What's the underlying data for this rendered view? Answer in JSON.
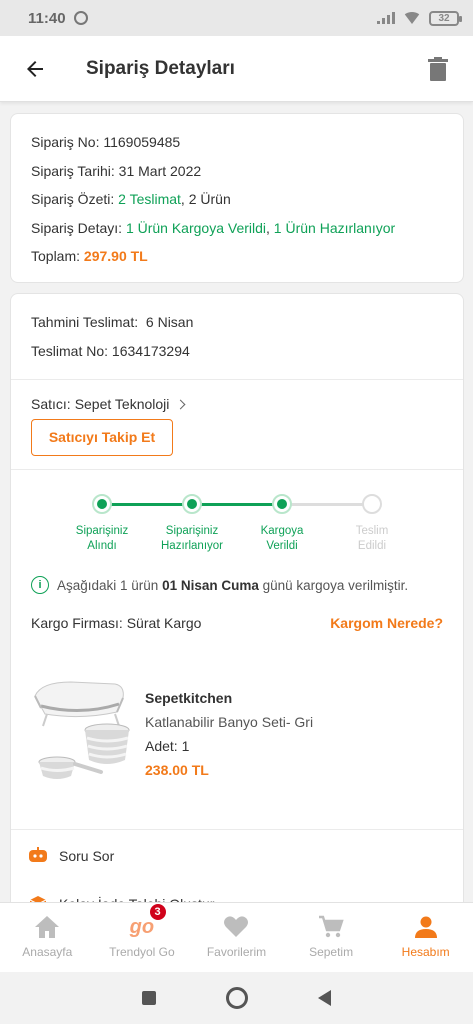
{
  "status_bar": {
    "time": "11:40",
    "battery": "32"
  },
  "header": {
    "title": "Sipariş Detayları"
  },
  "order": {
    "no_label": "Sipariş No:",
    "no_value": "1169059485",
    "date_label": "Sipariş Tarihi:",
    "date_value": "31 Mart 2022",
    "summary_label": "Sipariş Özeti:",
    "summary_deliveries": "2 Teslimat",
    "summary_sep": ", ",
    "summary_items": "2 Ürün",
    "detail_label": "Sipariş Detayı:",
    "detail_shipped": "1 Ürün Kargoya Verildi",
    "detail_sep": ", ",
    "detail_preparing": "1 Ürün Hazırlanıyor",
    "total_label": "Toplam:",
    "total_value": "297.90 TL"
  },
  "delivery": {
    "estimated_label": "Tahmini Teslimat:",
    "estimated_value": "6 Nisan",
    "delivery_no_label": "Teslimat No:",
    "delivery_no_value": "1634173294",
    "seller_label": "Satıcı:",
    "seller_value": "Sepet Teknoloji",
    "follow_button": "Satıcıyı Takip Et"
  },
  "tracker": {
    "steps": [
      {
        "line1": "Siparişiniz",
        "line2": "Alındı",
        "done": true
      },
      {
        "line1": "Siparişiniz",
        "line2": "Hazırlanıyor",
        "done": true
      },
      {
        "line1": "Kargoya",
        "line2": "Verildi",
        "done": true
      },
      {
        "line1": "Teslim",
        "line2": "Edildi",
        "done": false
      }
    ]
  },
  "shipping_info": {
    "prefix": "Aşağıdaki 1 ürün ",
    "date": "01 Nisan Cuma",
    "suffix": " günü kargoya verilmiştir."
  },
  "cargo": {
    "label": "Kargo Firması:",
    "value": "Sürat Kargo",
    "link": "Kargom Nerede?"
  },
  "product": {
    "brand": "Sepetkitchen",
    "name": "Katlanabilir Banyo Seti- Gri",
    "qty_label": "Adet:",
    "qty_value": "1",
    "price": "238.00 TL"
  },
  "actions": {
    "ask": "Soru Sor",
    "return": "Kolay İade Talebi Oluştur"
  },
  "bottom_nav": {
    "items": [
      {
        "label": "Anasayfa",
        "icon": "home-icon"
      },
      {
        "label": "Trendyol Go",
        "icon": "go-icon",
        "badge": "3",
        "logo": "go"
      },
      {
        "label": "Favorilerim",
        "icon": "heart-icon"
      },
      {
        "label": "Sepetim",
        "icon": "cart-icon"
      },
      {
        "label": "Hesabım",
        "icon": "user-icon",
        "active": true
      }
    ]
  },
  "colors": {
    "accent": "#f27a1a",
    "green": "#0fa157"
  }
}
